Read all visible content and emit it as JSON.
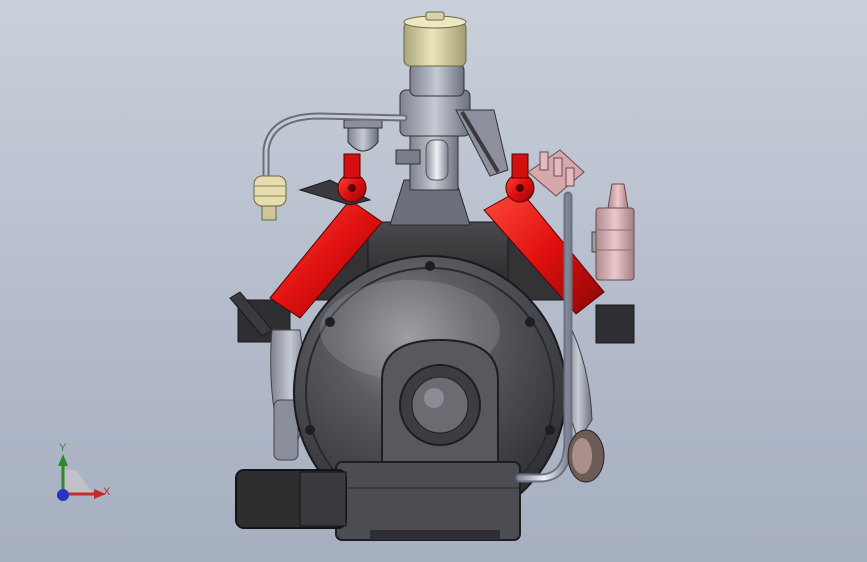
{
  "viewport": {
    "background_top": "#c9d0db",
    "background_bottom": "#a6afc0"
  },
  "model": {
    "name": "v8-engine-assembly",
    "colors": {
      "valve_covers": "#e11414",
      "block": "#3a3a3d",
      "bellhousing": "#4a4b50",
      "air_cleaner": "#d8d2a6",
      "coil": "#d8b4b8",
      "fuel_filter": "#e6dcae",
      "tubing": "#c8ccd6"
    }
  },
  "triad": {
    "y_label": "Y",
    "x_label": "X",
    "y_color": "#2c8a2c",
    "x_color": "#c62a2a",
    "z_color": "#2832c8"
  }
}
